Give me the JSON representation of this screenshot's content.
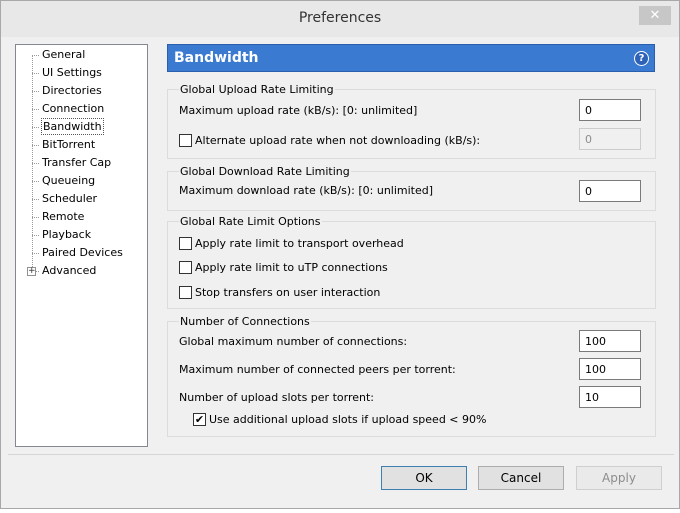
{
  "window": {
    "title": "Preferences",
    "close_glyph": "✕"
  },
  "tree": {
    "items": [
      {
        "label": "General"
      },
      {
        "label": "UI Settings"
      },
      {
        "label": "Directories"
      },
      {
        "label": "Connection"
      },
      {
        "label": "Bandwidth"
      },
      {
        "label": "BitTorrent"
      },
      {
        "label": "Transfer Cap"
      },
      {
        "label": "Queueing"
      },
      {
        "label": "Scheduler"
      },
      {
        "label": "Remote"
      },
      {
        "label": "Playback"
      },
      {
        "label": "Paired Devices"
      },
      {
        "label": "Advanced"
      }
    ],
    "selected": "Bandwidth",
    "expander_glyph": "+"
  },
  "header": {
    "title": "Bandwidth",
    "help_glyph": "?"
  },
  "upload": {
    "group_title": "Global Upload Rate Limiting",
    "max_label": "Maximum upload rate (kB/s): [0: unlimited]",
    "max_value": "0",
    "alt_label": "Alternate upload rate when not downloading (kB/s):",
    "alt_checked": false,
    "alt_value": "0"
  },
  "download": {
    "group_title": "Global Download Rate Limiting",
    "max_label": "Maximum download rate (kB/s): [0: unlimited]",
    "max_value": "0"
  },
  "options": {
    "group_title": "Global Rate Limit Options",
    "transport_label": "Apply rate limit to transport overhead",
    "utp_label": "Apply rate limit to uTP connections",
    "stop_label": "Stop transfers on user interaction"
  },
  "connections": {
    "group_title": "Number of Connections",
    "global_max_label": "Global maximum number of connections:",
    "global_max_value": "100",
    "peers_label": "Maximum number of connected peers per torrent:",
    "peers_value": "100",
    "slots_label": "Number of upload slots per torrent:",
    "slots_value": "10",
    "extra_slots_label": "Use additional upload slots if upload speed < 90%",
    "check_glyph": "✔"
  },
  "buttons": {
    "ok": "OK",
    "cancel": "Cancel",
    "apply": "Apply"
  }
}
